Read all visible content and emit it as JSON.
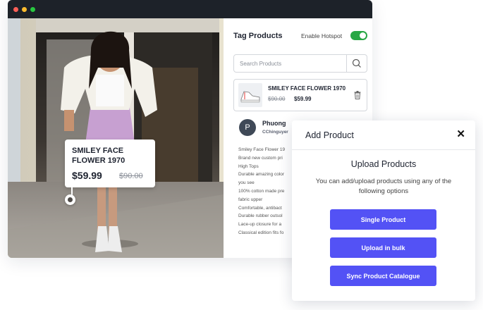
{
  "window": {
    "dot_colors": [
      "#fe5f57",
      "#febc2e",
      "#28c840"
    ]
  },
  "tag_panel": {
    "title": "Tag Products",
    "hotspot_label": "Enable Hotspot",
    "hotspot_enabled": true,
    "search": {
      "placeholder": "Search Products",
      "value": "",
      "icon": "search-icon"
    },
    "product": {
      "name": "SMILEY FACE FLOWER 1970",
      "old_price": "$90.00",
      "new_price": "$59.99",
      "delete_icon": "trash-icon"
    }
  },
  "user": {
    "avatar_letter": "P",
    "name": "Phuong",
    "handle": "CChinguyer",
    "description_lines": [
      "Smiley Face Flower 19",
      "Brand new custom pri",
      "High Tops",
      "Durable amazing color",
      "you see",
      "100% cotton made pre",
      "fabric upper",
      "Comfortable, antibact",
      "Durable rubber outsol",
      "Lace-up closure for a",
      "Classical edition fits fo"
    ]
  },
  "photo_tag": {
    "name": "SMILEY FACE FLOWER 1970",
    "new_price": "$59.99",
    "old_price": "$90.00"
  },
  "modal": {
    "title": "Add Product",
    "close_icon": "close-icon",
    "heading": "Upload Products",
    "subtitle": "You can add/upload products using any of the following options",
    "buttons": [
      "Single Product",
      "Upload in bulk",
      "Sync Product Catalogue"
    ],
    "accent_color": "#5352f5"
  }
}
